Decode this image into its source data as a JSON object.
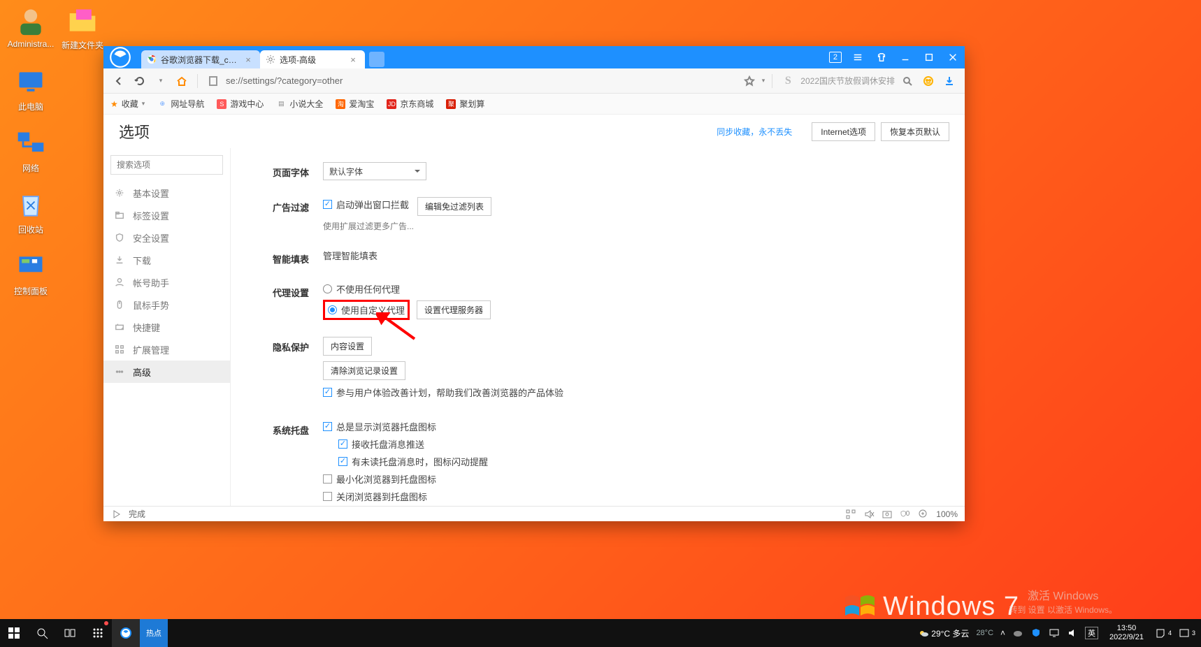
{
  "desktop": {
    "icons": [
      {
        "name": "administrator-user",
        "label": "Administra..."
      },
      {
        "name": "folder-new",
        "label": "新建文件夹"
      },
      {
        "name": "this-pc",
        "label": "此电脑"
      },
      {
        "name": "network",
        "label": "网络"
      },
      {
        "name": "recycle-bin",
        "label": "回收站"
      },
      {
        "name": "control-panel",
        "label": "控制面板"
      }
    ]
  },
  "tabs": [
    {
      "label": "谷歌浏览器下载_chrome...",
      "active": false
    },
    {
      "label": "选项-高级",
      "active": true
    }
  ],
  "winbadge": "2",
  "addr": "se://settings/?category=other",
  "addr_hint": "2022国庆节放假调休安排",
  "bookmarks": {
    "fav": "收藏",
    "items": [
      {
        "label": "网址导航",
        "color": "#6aa6ff",
        "glyph": "⊕"
      },
      {
        "label": "游戏中心",
        "color": "#ff5a5a",
        "glyph": "S"
      },
      {
        "label": "小说大全",
        "color": "#8a8a8a",
        "glyph": "≡"
      },
      {
        "label": "爱淘宝",
        "color": "#ff6600",
        "glyph": "淘"
      },
      {
        "label": "京东商城",
        "color": "#e2231a",
        "glyph": "JD"
      },
      {
        "label": "聚划算",
        "color": "#d81e06",
        "glyph": "聚"
      }
    ]
  },
  "options": {
    "title": "选项",
    "sync_link": "同步收藏，永不丢失",
    "btn_ie": "Internet选项",
    "btn_reset": "恢复本页默认",
    "search_ph": "搜索选项",
    "menu": [
      {
        "label": "基本设置",
        "icon": "gear"
      },
      {
        "label": "标签设置",
        "icon": "tabs"
      },
      {
        "label": "安全设置",
        "icon": "shield"
      },
      {
        "label": "下载",
        "icon": "download"
      },
      {
        "label": "帐号助手",
        "icon": "user"
      },
      {
        "label": "鼠标手势",
        "icon": "mouse"
      },
      {
        "label": "快捷键",
        "icon": "keyboard"
      },
      {
        "label": "扩展管理",
        "icon": "grid"
      },
      {
        "label": "高级",
        "icon": "dots",
        "active": true
      }
    ],
    "sections": {
      "font": {
        "label": "页面字体",
        "select": "默认字体"
      },
      "adblock": {
        "label": "广告过滤",
        "cb": "启动弹出窗口拦截",
        "btn": "编辑免过滤列表",
        "hint": "使用扩展过滤更多广告..."
      },
      "autofill": {
        "label": "智能填表",
        "link": "管理智能填表"
      },
      "proxy": {
        "label": "代理设置",
        "r1": "不使用任何代理",
        "r2": "使用自定义代理",
        "btn": "设置代理服务器"
      },
      "privacy": {
        "label": "隐私保护",
        "btn1": "内容设置",
        "btn2": "清除浏览记录设置",
        "cb": "参与用户体验改善计划，帮助我们改善浏览器的产品体验"
      },
      "tray": {
        "label": "系统托盘",
        "c1": "总是显示浏览器托盘图标",
        "c2": "接收托盘消息推送",
        "c3": "有未读托盘消息时，图标闪动提醒",
        "c4": "最小化浏览器到托盘图标",
        "c5": "关闭浏览器到托盘图标"
      }
    }
  },
  "statusbar": {
    "done": "完成",
    "zoom": "100%",
    "mute_badge": "0"
  },
  "watermark": {
    "brand": "Windows",
    "ver": "7",
    "line1": "激活 Windows",
    "line2": "转到 设置 以激活 Windows。"
  },
  "tray": {
    "weather": "29°C 多云",
    "temp2": "28°C",
    "ime": "英",
    "time": "13:50",
    "date": "2022/9/21",
    "notif1": "4",
    "notif2": "3"
  }
}
